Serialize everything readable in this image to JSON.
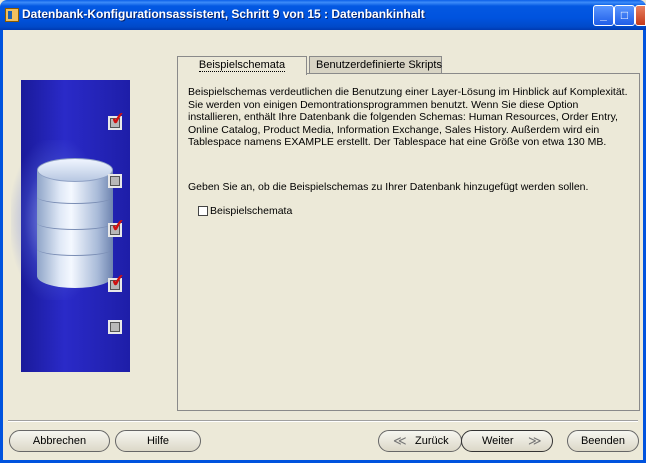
{
  "window": {
    "title": "Datenbank-Konfigurationsassistent, Schritt 9 von 15 : Datenbankinhalt",
    "min_label": "_",
    "max_label": "□",
    "close_label": "X"
  },
  "tabs": [
    {
      "label": "Beispielschemata",
      "active": true
    },
    {
      "label": "Benutzerdefinierte Skripts",
      "active": false
    }
  ],
  "panel": {
    "description": "Beispielschemas verdeutlichen die Benutzung einer Layer-Lösung im Hinblick auf Komplexität. Sie werden von einigen Demontrationsprogrammen benutzt. Wenn Sie diese Option installieren, enthält Ihre Datenbank die folgenden Schemas: Human Resources, Order Entry, Online Catalog, Product Media, Information Exchange, Sales History. Außerdem wird ein Tablespace namens EXAMPLE erstellt. Der Tablespace hat eine Größe von etwa 130 MB.",
    "question": "Geben Sie an, ob die Beispielschemas zu Ihrer Datenbank hinzugefügt werden sollen.",
    "checkbox": {
      "label": "Beispielschemata",
      "checked": false
    }
  },
  "graphic": {
    "steps": [
      {
        "state": "checked"
      },
      {
        "state": "unchecked"
      },
      {
        "state": "checked"
      },
      {
        "state": "checked"
      },
      {
        "state": "unchecked"
      }
    ],
    "check_glyph": "✔"
  },
  "buttons": {
    "cancel": "Abbrechen",
    "help": "Hilfe",
    "back": "Zurück",
    "back_arrow": "≪",
    "next": "Weiter",
    "next_arrow": "≫",
    "finish": "Beenden"
  },
  "colors": {
    "titlebar": "#0053de",
    "graphic_bg": "#2222b0",
    "check_mark": "#d01010",
    "window_bg": "#ece9d8"
  }
}
